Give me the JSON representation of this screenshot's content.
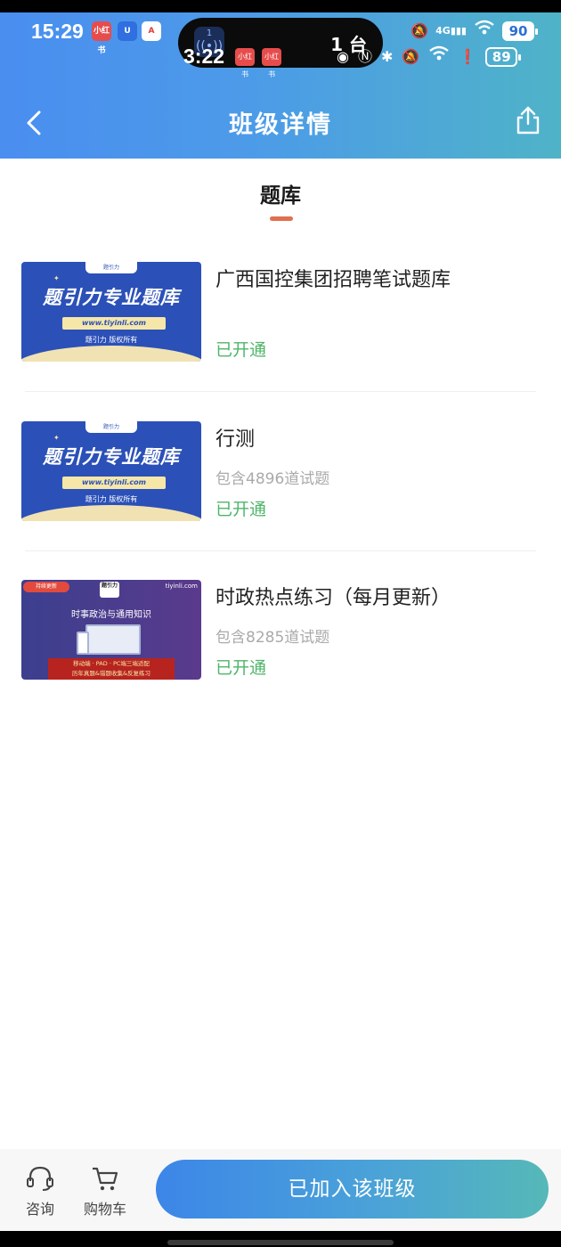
{
  "status_bar": {
    "time": "15:29",
    "badges": [
      "小红书",
      "U",
      "A"
    ],
    "island_count": "1",
    "island_text": "1 台",
    "network": "4G",
    "battery": "90"
  },
  "ghost_status_bar": {
    "time": "3:22",
    "badges": [
      "小红书",
      "小红书"
    ],
    "battery": "89"
  },
  "nav": {
    "title": "班级详情"
  },
  "section": {
    "title": "题库"
  },
  "items": [
    {
      "name": "广西国控集团招聘笔试题库",
      "count": "",
      "status": "已开通",
      "thumb": {
        "tag": "题引力",
        "headline": "题引力专业题库",
        "url": "www.tiyinli.com",
        "owner": "题引力 版权所有"
      }
    },
    {
      "name": "行测",
      "count": "包含4896道试题",
      "status": "已开通",
      "thumb": {
        "tag": "题引力",
        "headline": "题引力专业题库",
        "url": "www.tiyinli.com",
        "owner": "题引力 版权所有"
      }
    },
    {
      "name": "时政热点练习（每月更新）",
      "count": "包含8285道试题",
      "status": "已开通",
      "thumb": {
        "tag": "持续更新",
        "site": "tiyinli.com",
        "logo": "题引力",
        "subtitle": "时事政治与通用知识",
        "banner_line1": "移动端 · PAD · PC端三端适配",
        "banner_line2": "历年真题&错题收集&反复练习"
      }
    }
  ],
  "bottom_bar": {
    "consult_label": "咨询",
    "cart_label": "购物车",
    "join_label": "已加入该班级"
  },
  "colors": {
    "header_gradient_start": "#4a8ef0",
    "header_gradient_end": "#4fb3c8",
    "accent_underline": "#e0704e",
    "status_green": "#4fb56a"
  }
}
